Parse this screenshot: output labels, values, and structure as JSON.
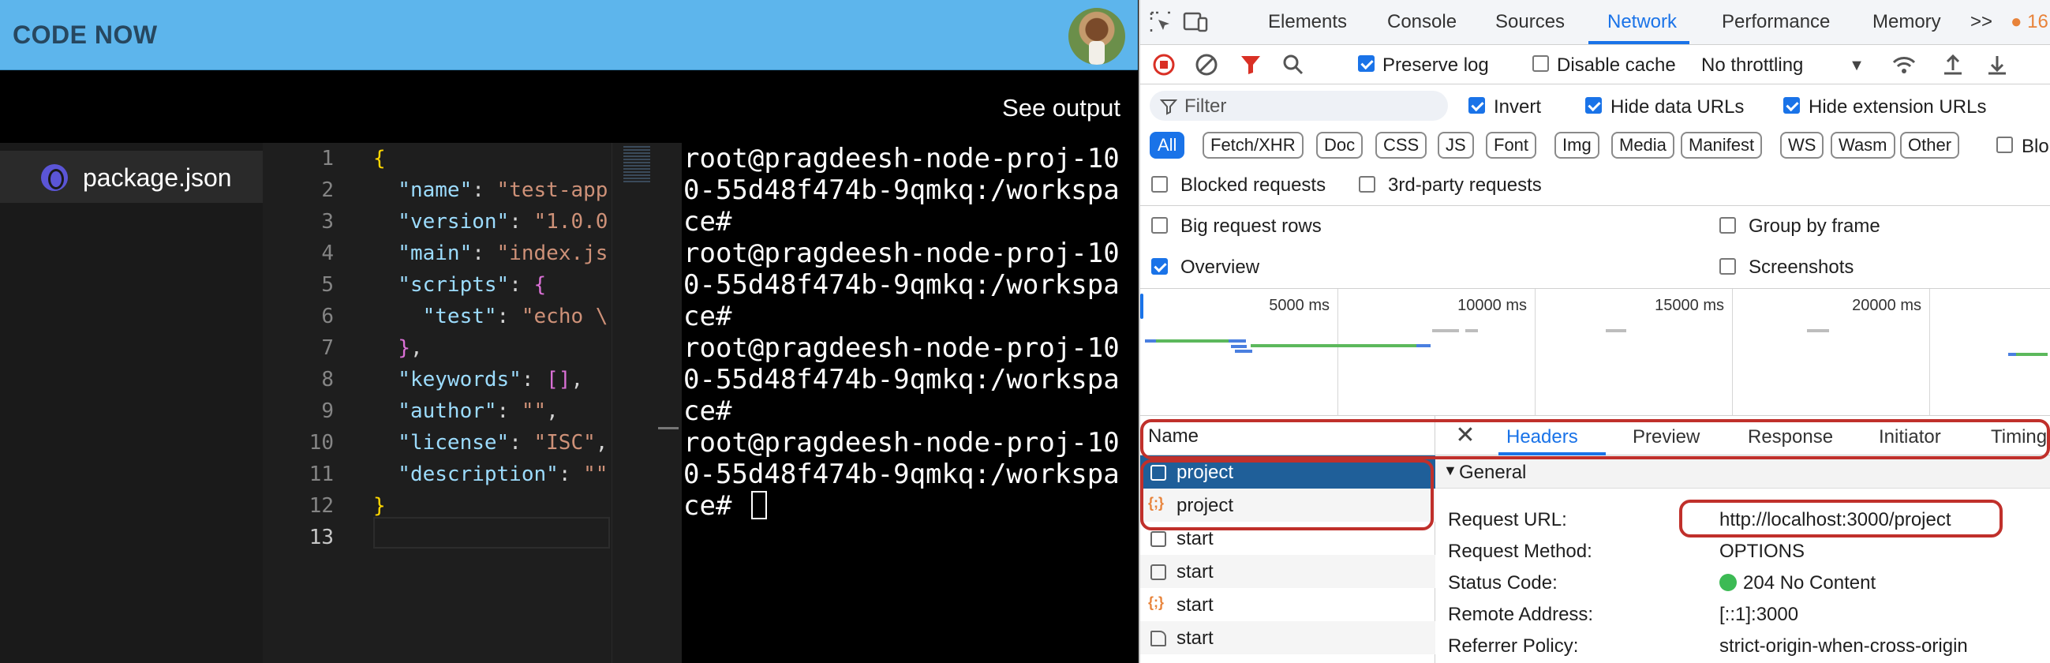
{
  "app": {
    "brand": "CODE NOW",
    "see_output": "See output",
    "file": "package.json"
  },
  "editor": {
    "line_numbers": [
      "1",
      "2",
      "3",
      "4",
      "5",
      "6",
      "7",
      "8",
      "9",
      "10",
      "11",
      "12",
      "13"
    ],
    "lines": [
      [
        {
          "t": "{",
          "c": "p"
        }
      ],
      [
        {
          "t": "  \"name\"",
          "c": "k"
        },
        {
          "t": ": ",
          "c": ""
        },
        {
          "t": "\"test-app",
          "c": "s"
        }
      ],
      [
        {
          "t": "  \"version\"",
          "c": "k"
        },
        {
          "t": ": ",
          "c": ""
        },
        {
          "t": "\"1.0.0",
          "c": "s"
        }
      ],
      [
        {
          "t": "  \"main\"",
          "c": "k"
        },
        {
          "t": ": ",
          "c": ""
        },
        {
          "t": "\"index.js",
          "c": "s"
        }
      ],
      [
        {
          "t": "  \"scripts\"",
          "c": "k"
        },
        {
          "t": ": ",
          "c": ""
        },
        {
          "t": "{",
          "c": "b"
        }
      ],
      [
        {
          "t": "    \"test\"",
          "c": "k"
        },
        {
          "t": ": ",
          "c": ""
        },
        {
          "t": "\"echo \\",
          "c": "s"
        }
      ],
      [
        {
          "t": "  ",
          "c": ""
        },
        {
          "t": "}",
          "c": "b"
        },
        {
          "t": ",",
          "c": ""
        }
      ],
      [
        {
          "t": "  \"keywords\"",
          "c": "k"
        },
        {
          "t": ": ",
          "c": ""
        },
        {
          "t": "[]",
          "c": "b"
        },
        {
          "t": ",",
          "c": ""
        }
      ],
      [
        {
          "t": "  \"author\"",
          "c": "k"
        },
        {
          "t": ": ",
          "c": ""
        },
        {
          "t": "\"\"",
          "c": "s"
        },
        {
          "t": ",",
          "c": ""
        }
      ],
      [
        {
          "t": "  \"license\"",
          "c": "k"
        },
        {
          "t": ": ",
          "c": ""
        },
        {
          "t": "\"ISC\"",
          "c": "s"
        },
        {
          "t": ",",
          "c": ""
        }
      ],
      [
        {
          "t": "  \"description\"",
          "c": "k"
        },
        {
          "t": ": ",
          "c": ""
        },
        {
          "t": "\"\"",
          "c": "s"
        }
      ],
      [
        {
          "t": "}",
          "c": "p"
        }
      ],
      []
    ]
  },
  "terminal": {
    "lines": [
      "root@pragdeesh-node-proj-10",
      "0-55d48f474b-9qmkq:/workspa",
      "ce#",
      "root@pragdeesh-node-proj-10",
      "0-55d48f474b-9qmkq:/workspa",
      "ce#",
      "root@pragdeesh-node-proj-10",
      "0-55d48f474b-9qmkq:/workspa",
      "ce#",
      "root@pragdeesh-node-proj-10",
      "0-55d48f474b-9qmkq:/workspa",
      "ce# "
    ]
  },
  "devtools": {
    "tabs": [
      "Elements",
      "Console",
      "Sources",
      "Network",
      "Performance",
      "Memory"
    ],
    "more": ">>",
    "badge": "16",
    "preserve_log": "Preserve log",
    "disable_cache": "Disable cache",
    "throttling": "No throttling",
    "filter_placeholder": "Filter",
    "invert": "Invert",
    "hide_data_urls": "Hide data URLs",
    "hide_extension_urls": "Hide extension URLs",
    "chips": [
      "All",
      "Fetch/XHR",
      "Doc",
      "CSS",
      "JS",
      "Font",
      "Img",
      "Media",
      "Manifest",
      "WS",
      "Wasm",
      "Other"
    ],
    "blocked_cookies": "Blo",
    "blocked_requests": "Blocked requests",
    "third_party": "3rd-party requests",
    "big_rows": "Big request rows",
    "group_by_frame": "Group by frame",
    "overview": "Overview",
    "screenshots": "Screenshots",
    "timeline_labels": [
      "5000 ms",
      "10000 ms",
      "15000 ms",
      "20000 ms"
    ],
    "name_header": "Name",
    "requests": [
      {
        "name": "project",
        "type": "doc"
      },
      {
        "name": "project",
        "type": "xhr"
      },
      {
        "name": "start",
        "type": "doc"
      },
      {
        "name": "start",
        "type": "doc"
      },
      {
        "name": "start",
        "type": "xhr"
      },
      {
        "name": "start",
        "type": "file"
      }
    ],
    "detail_tabs": [
      "Headers",
      "Preview",
      "Response",
      "Initiator",
      "Timing"
    ],
    "general": "General",
    "headers": [
      {
        "k": "Request URL:",
        "v": "http://localhost:3000/project"
      },
      {
        "k": "Request Method:",
        "v": "OPTIONS"
      },
      {
        "k": "Status Code:",
        "v": "204 No Content"
      },
      {
        "k": "Remote Address:",
        "v": "[::1]:3000"
      },
      {
        "k": "Referrer Policy:",
        "v": "strict-origin-when-cross-origin"
      }
    ],
    "status_color": "#3cba54",
    "accent": "#1a73e8"
  }
}
